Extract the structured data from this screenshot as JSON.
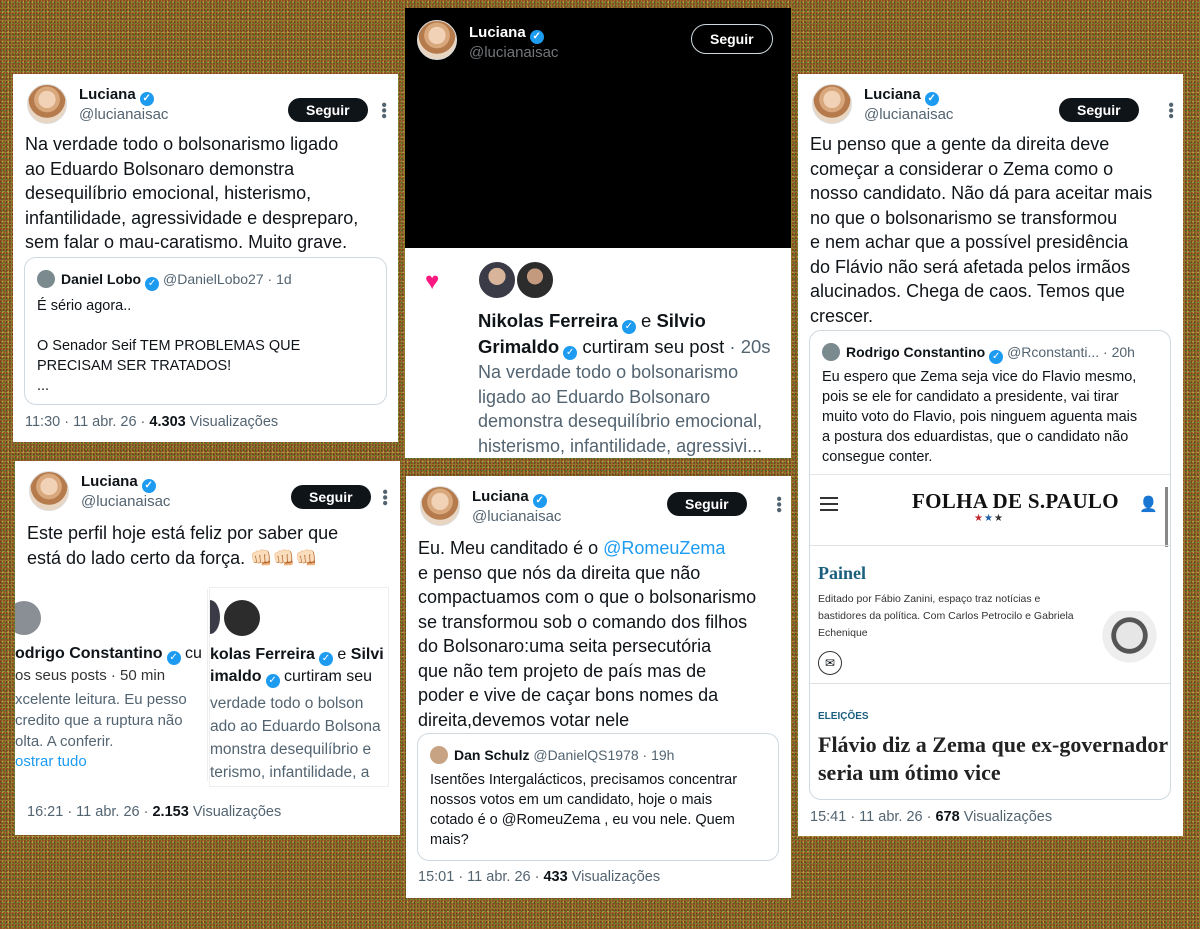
{
  "profile": {
    "name": "Luciana",
    "handle": "@lucianaisac",
    "follow_label": "Seguir",
    "verified_icon": "verified-badge-icon"
  },
  "views_label": "Visualizações",
  "tweet1": {
    "text": "Na verdade todo o bolsonarismo ligado\nao Eduardo Bolsonaro demonstra\ndesequilíbrio emocional, histerismo,\ninfantilidade, agressividade e despreparo,\nsem falar o mau-caratismo. Muito grave.",
    "quote": {
      "author": "Daniel Lobo",
      "handle": "@DanielLobo27",
      "time": "· 1d",
      "text": "É sério agora..\n\nO Senador Seif TEM PROBLEMAS QUE\nPRECISAM SER TRATADOS!\n..."
    },
    "timestamp": "11:30 · 11 abr. 26 ·",
    "views": "4.303"
  },
  "tweet2": {
    "notif_names_a": "Nikolas Ferreira",
    "notif_connector": "e",
    "notif_names_b": "Silvio",
    "notif_names_c": "Grimaldo",
    "notif_action": "curtiram seu post",
    "notif_time": "· 20s",
    "notif_text": "Na verdade todo o bolsonarismo\nligado ao Eduardo Bolsonaro\ndemonstra desequilíbrio emocional,\nhisterismo, infantilidade, agressivi..."
  },
  "tweet3": {
    "text": "Eu penso que a gente da direita deve\ncomeçar a considerar o Zema como o\nnosso candidato. Não dá para aceitar mais\nno que o bolsonarismo se transformou\ne nem achar que a possível presidência\ndo Flávio não será afetada pelos irmãos\nalucinados. Chega de caos. Temos que\ncrescer.",
    "quote": {
      "author": "Rodrigo Constantino",
      "handle": "@Rconstanti...",
      "time": "· 20h",
      "text": "Eu espero que Zema seja vice do Flavio mesmo,\npois se ele for candidato a presidente, vai tirar\nmuito voto do Flavio, pois ninguem aguenta mais\na postura dos eduardistas, que o candidato não\nconsegue conter."
    },
    "article": {
      "masthead": "FOLHA DE S.PAULO",
      "section": "Painel",
      "section_desc": "Editado por Fábio Zanini, espaço traz notícias e\nbastidores da política. Com Carlos Petrocilo e Gabriela\nEchenique",
      "tag": "ELEIÇÕES",
      "headline": "Flávio diz a Zema que ex-governador\nseria um ótimo vice"
    },
    "timestamp": "15:41 · 11 abr. 26 ·",
    "views": "678"
  },
  "tweet4": {
    "text": "Este perfil hoje está feliz por saber que\nestá do lado certo da força. 👊🏻👊🏻👊🏻",
    "left_panel": {
      "name_partial": "odrigo Constantino",
      "suffix": "cu",
      "line2": "os seus posts · 50 min",
      "text": "xcelente leitura. Eu pesso\ncredito que a ruptura não\nolta. A conferir.",
      "link": "ostrar tudo"
    },
    "right_panel": {
      "name_partial": "kolas Ferreira",
      "connector": "e",
      "name_b": "Silvi",
      "line2a": "imaldo",
      "line2b": "curtiram seu",
      "text": "verdade todo o bolson\nado ao Eduardo Bolsona\nmonstra desequilíbrio e\nterismo, infantilidade, a"
    },
    "timestamp": "16:21 · 11 abr. 26 ·",
    "views": "2.153"
  },
  "tweet5": {
    "text_before": "Eu. Meu canditado é o ",
    "mention": "@RomeuZema",
    "text_after": "\ne penso que nós da direita que não\ncompactuamos com o que o bolsonarismo\nse transformou sob o comando dos filhos\ndo Bolsonaro:uma seita persecutória\nque não tem projeto de país mas de\npoder e vive de caçar bons nomes da\ndireita,devemos votar nele",
    "quote": {
      "author": "Dan Schulz",
      "handle": "@DanielQS1978",
      "time": "· 19h",
      "text": "Isentões Intergalácticos, precisamos concentrar\nnossos votos em um candidato, hoje o mais\ncotado é o @RomeuZema , eu vou nele. Quem\nmais?"
    },
    "timestamp": "15:01 · 11 abr. 26 ·",
    "views": "433"
  },
  "colors": {
    "accent": "#1d9bf0",
    "like": "#f91880",
    "follow_bg": "#0f1419",
    "secondary_text": "#536471",
    "folha_blue": "#1b5e7e"
  }
}
